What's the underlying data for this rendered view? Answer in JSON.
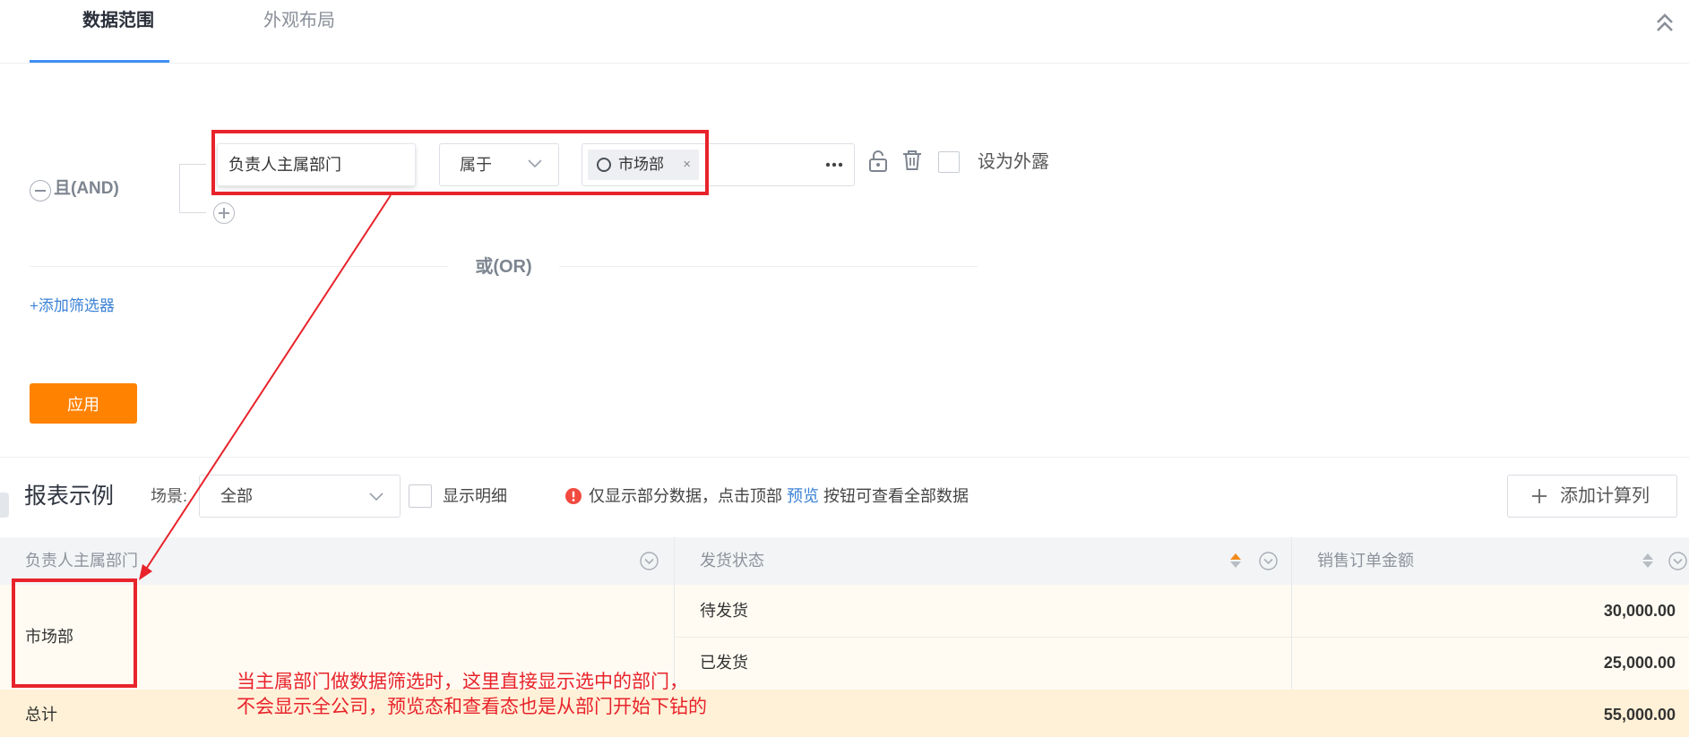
{
  "tabs": {
    "scope": "数据范围",
    "appearance": "外观布局"
  },
  "filter": {
    "and_label": "且(AND)",
    "field": "负责人主属部门",
    "operator": "属于",
    "value_tag": "市场部",
    "tag_close": "×",
    "expose_label": "设为外露",
    "or_label": "或(OR)",
    "add_filter": "+添加筛选器",
    "apply": "应用"
  },
  "report": {
    "title": "报表示例",
    "scene_label": "场景:",
    "scene_value": "全部",
    "detail_label": "显示明细",
    "notice_before": "仅显示部分数据，点击顶部",
    "notice_link": "预览",
    "notice_after": "按钮可查看全部数据",
    "add_calc": "添加计算列"
  },
  "table": {
    "columns": [
      "负责人主属部门",
      "发货状态",
      "销售订单金额"
    ],
    "department": "市场部",
    "rows": [
      {
        "status": "待发货",
        "amount": "30,000.00"
      },
      {
        "status": "已发货",
        "amount": "25,000.00"
      }
    ],
    "total_label": "总计",
    "total_value": "55,000.00"
  },
  "annotation": {
    "line1": "当主属部门做数据筛选时，这里直接显示选中的部门，",
    "line2": "不会显示全公司，预览态和查看态也是从部门开始下钻的"
  },
  "colors": {
    "accent": "#3d8ff5",
    "primary_button": "#ff8200",
    "link": "#3b82d6",
    "highlight": "#e8232b",
    "row_bg": "#fffbf2",
    "total_bg": "#fff1d7"
  }
}
